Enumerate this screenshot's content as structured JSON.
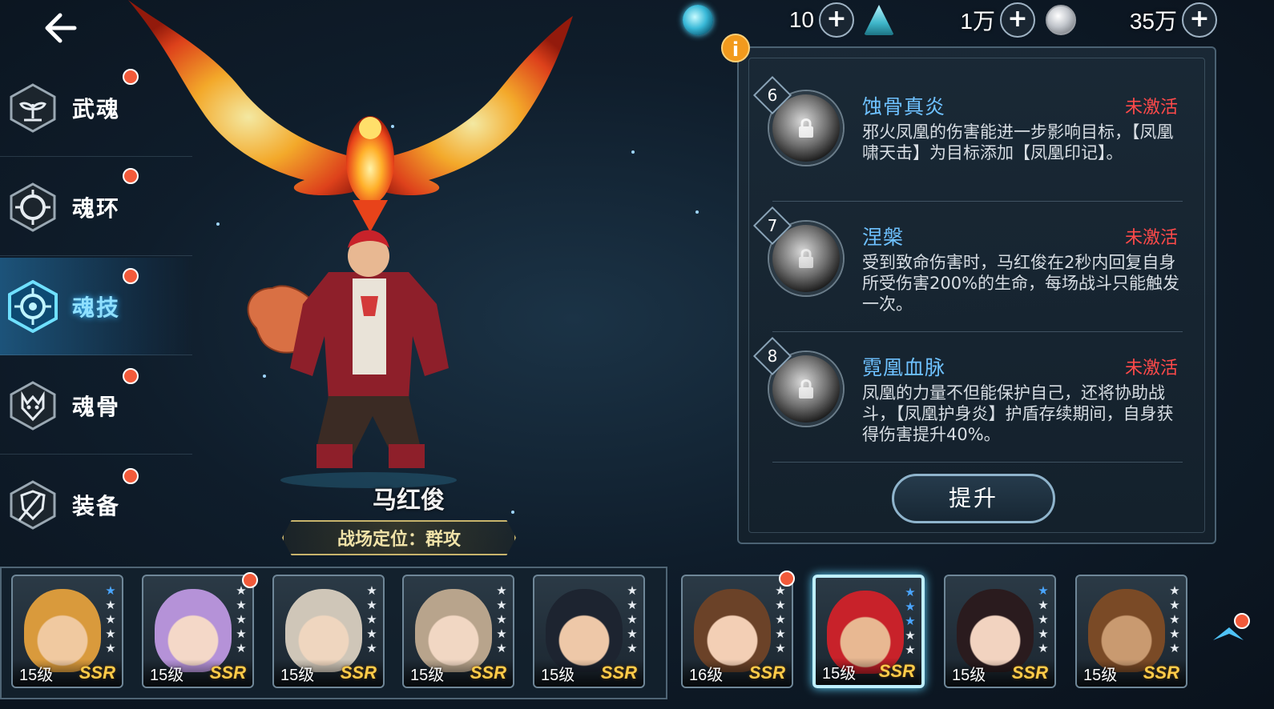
{
  "header": {
    "currencies": [
      {
        "icon": "soul-orb-icon",
        "value": "10"
      },
      {
        "icon": "crystal-pile-icon",
        "value": "1万"
      },
      {
        "icon": "silver-coin-icon",
        "value": "35万"
      }
    ]
  },
  "sidebar": {
    "items": [
      {
        "label": "武魂",
        "icon": "sprout-icon",
        "active": false
      },
      {
        "label": "魂环",
        "icon": "ring-icon",
        "active": false
      },
      {
        "label": "魂技",
        "icon": "target-icon",
        "active": true
      },
      {
        "label": "魂骨",
        "icon": "bone-icon",
        "active": false
      },
      {
        "label": "装备",
        "icon": "shield-icon",
        "active": false
      }
    ]
  },
  "character": {
    "name": "马红俊",
    "role": "战场定位：群攻"
  },
  "skills": [
    {
      "number": "6",
      "title": "蚀骨真炎",
      "status": "未激活",
      "description": "邪火凤凰的伤害能进一步影响目标，【凤凰啸天击】为目标添加【凤凰印记】。"
    },
    {
      "number": "7",
      "title": "涅槃",
      "status": "未激活",
      "description": "受到致命伤害时，马红俊在2秒内回复自身所受伤害200%的生命，每场战斗只能触发一次。"
    },
    {
      "number": "8",
      "title": "霓凰血脉",
      "status": "未激活",
      "description": "凤凰的力量不但能保护自己，还将协助战斗，【凤凰护身炎】护盾存续期间，自身获得伤害提升40%。"
    }
  ],
  "upgrade_label": "提升",
  "roster": [
    {
      "level": "15级",
      "rarity": "SSR",
      "blue_stars": 1,
      "hair": "#d99a3c",
      "skin": "#f0c9a0"
    },
    {
      "level": "15级",
      "rarity": "SSR",
      "blue_stars": 0,
      "hair": "#b592d8",
      "skin": "#f4d8c8"
    },
    {
      "level": "15级",
      "rarity": "SSR",
      "blue_stars": 0,
      "hair": "#cfc6b8",
      "skin": "#efd6bf"
    },
    {
      "level": "15级",
      "rarity": "SSR",
      "blue_stars": 0,
      "hair": "#b8a48c",
      "skin": "#f1d7c3"
    },
    {
      "level": "15级",
      "rarity": "SSR",
      "blue_stars": 0,
      "hair": "#1d2430",
      "skin": "#eec8a8"
    },
    {
      "level": "16级",
      "rarity": "SSR",
      "blue_stars": 0,
      "hair": "#6b4228",
      "skin": "#f3cfb5"
    },
    {
      "level": "15级",
      "rarity": "SSR",
      "blue_stars": 3,
      "hair": "#c8222a",
      "skin": "#e8b892"
    },
    {
      "level": "15级",
      "rarity": "SSR",
      "blue_stars": 1,
      "hair": "#2a1b1e",
      "skin": "#f2d3c0"
    },
    {
      "level": "15级",
      "rarity": "SSR",
      "blue_stars": 0,
      "hair": "#7a4a26",
      "skin": "#c99a70"
    }
  ]
}
